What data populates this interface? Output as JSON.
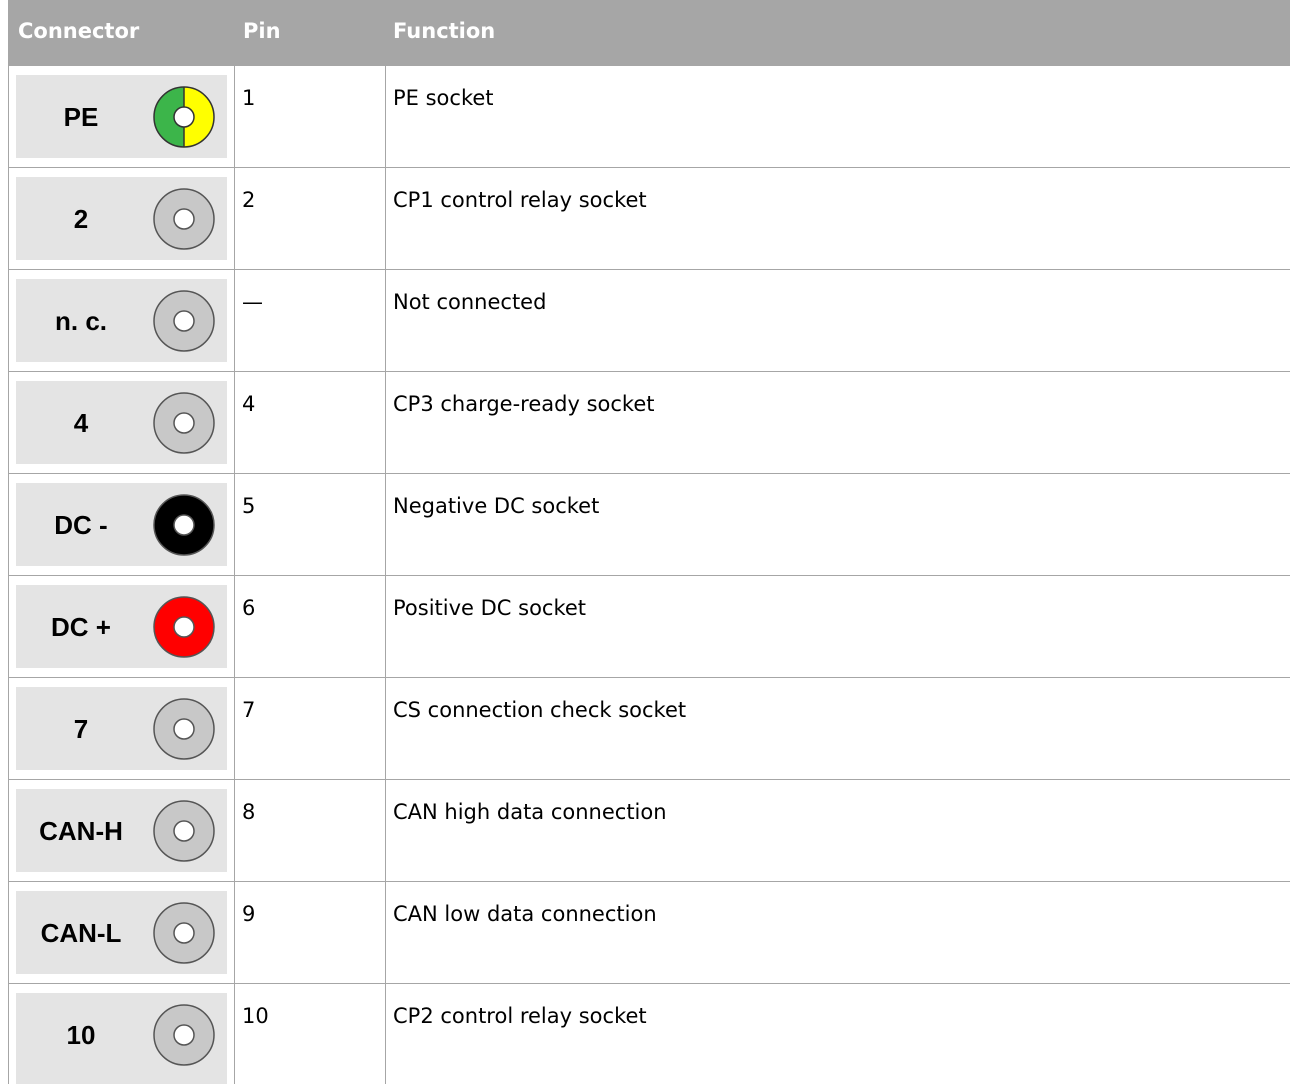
{
  "table": {
    "headers": {
      "connector": "Connector",
      "pin": "Pin",
      "function": "Function"
    },
    "rows": [
      {
        "connector": "PE",
        "pin": "1",
        "function": "PE socket",
        "socket": "pe-socket-icon"
      },
      {
        "connector": "2",
        "pin": "2",
        "function": "CP1 control relay socket",
        "socket": "grey-socket-icon"
      },
      {
        "connector": "n. c.",
        "pin": "—",
        "function": "Not connected",
        "socket": "grey-socket-icon"
      },
      {
        "connector": "4",
        "pin": "4",
        "function": "CP3 charge-ready socket",
        "socket": "grey-socket-icon"
      },
      {
        "connector": "DC -",
        "pin": "5",
        "function": "Negative DC socket",
        "socket": "black-socket-icon"
      },
      {
        "connector": "DC +",
        "pin": "6",
        "function": "Positive DC socket",
        "socket": "red-socket-icon"
      },
      {
        "connector": "7",
        "pin": "7",
        "function": "CS connection check socket",
        "socket": "grey-socket-icon"
      },
      {
        "connector": "CAN-H",
        "pin": "8",
        "function": "CAN high data connection",
        "socket": "grey-socket-icon"
      },
      {
        "connector": "CAN-L",
        "pin": "9",
        "function": "CAN low data connection",
        "socket": "grey-socket-icon"
      },
      {
        "connector": "10",
        "pin": "10",
        "function": "CP2 control relay socket",
        "socket": "grey-socket-icon"
      }
    ]
  },
  "colors": {
    "header_bg": "#a6a6a6",
    "connector_bg": "#e4e4e4",
    "pe_green": "#3cb54a",
    "pe_yellow": "#ffff00",
    "grey_socket": "#c8c8c8",
    "black_socket": "#000000",
    "red_socket": "#ff0000"
  }
}
